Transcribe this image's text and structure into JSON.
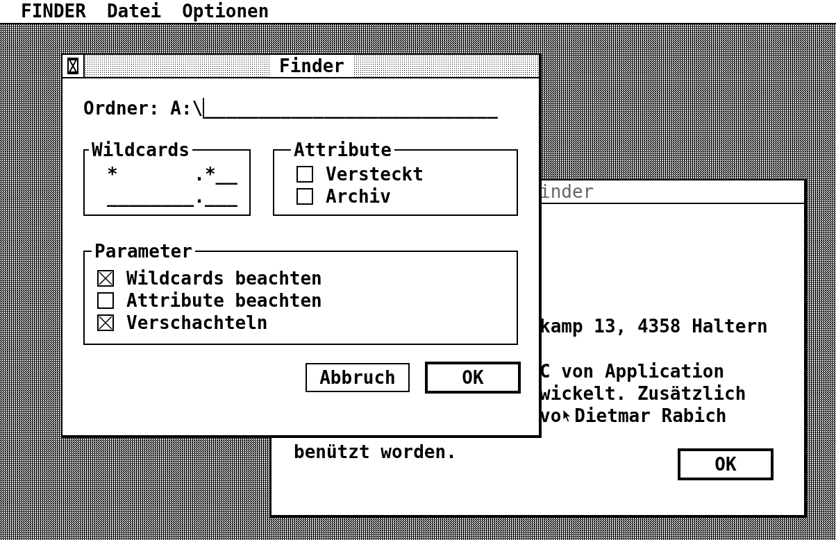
{
  "menu_bar": [
    {
      "label": "FINDER"
    },
    {
      "label": "Datei"
    },
    {
      "label": "Optionen"
    }
  ],
  "back_window": {
    "title": "inder",
    "active": false,
    "lines": [
      [
        "kamp 13, 4358 Haltern"
      ],
      [
        "C von Application"
      ],
      [
        "wickelt. Zusätzlich"
      ],
      [
        "vo",
        "Dietmar Rabich"
      ]
    ],
    "last_line": "benützt worden.",
    "buttons": [
      {
        "label": "OK",
        "default": true
      }
    ]
  },
  "front_window": {
    "title": "Finder",
    "active": true,
    "folder": {
      "label": "Ordner:",
      "value": "A:\\",
      "blank": "___________________________"
    },
    "wildcards": {
      "title": "Wildcards",
      "rows": [
        "*       .*__",
        "________.___"
      ]
    },
    "attributes": {
      "title": "Attribute",
      "options": [
        {
          "label": "Versteckt",
          "checked": false
        },
        {
          "label": "Archiv",
          "checked": false
        }
      ]
    },
    "parameters": {
      "title": "Parameter",
      "options": [
        {
          "label": "Wildcards beachten",
          "checked": true
        },
        {
          "label": "Attribute beachten",
          "checked": false
        },
        {
          "label": "Verschachteln",
          "checked": true
        }
      ]
    },
    "buttons": [
      {
        "label": "Abbruch",
        "default": false
      },
      {
        "label": "OK",
        "default": true
      }
    ]
  }
}
